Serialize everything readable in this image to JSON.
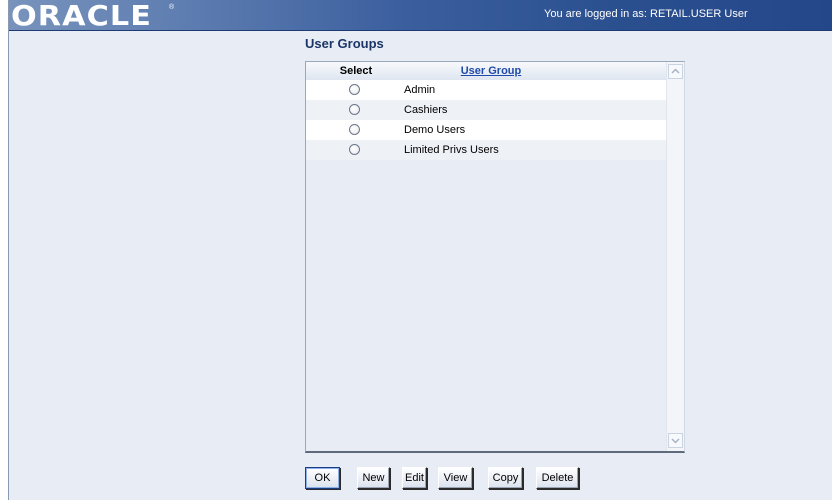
{
  "header": {
    "logo_text": "ORACLE",
    "registered_mark": "®",
    "login_status": "You are logged in as: RETAIL.USER User"
  },
  "page": {
    "title": "User Groups"
  },
  "table": {
    "columns": {
      "select": "Select",
      "user_group": "User Group"
    },
    "rows": [
      {
        "name": "Admin",
        "selected": false
      },
      {
        "name": "Cashiers",
        "selected": false
      },
      {
        "name": "Demo Users",
        "selected": false
      },
      {
        "name": "Limited Privs Users",
        "selected": false
      }
    ]
  },
  "scrollbar": {
    "up_icon": "chevron-up-icon",
    "down_icon": "chevron-down-icon"
  },
  "toolbar": {
    "ok_label": "OK",
    "new_label": "New",
    "edit_label": "Edit",
    "view_label": "View",
    "copy_label": "Copy",
    "delete_label": "Delete"
  },
  "colors": {
    "header_dark": "#24478a",
    "header_light": "#7893bc",
    "page_background": "#e8edf5",
    "title_color": "#1a3566",
    "link_color": "#1f4aa8"
  }
}
